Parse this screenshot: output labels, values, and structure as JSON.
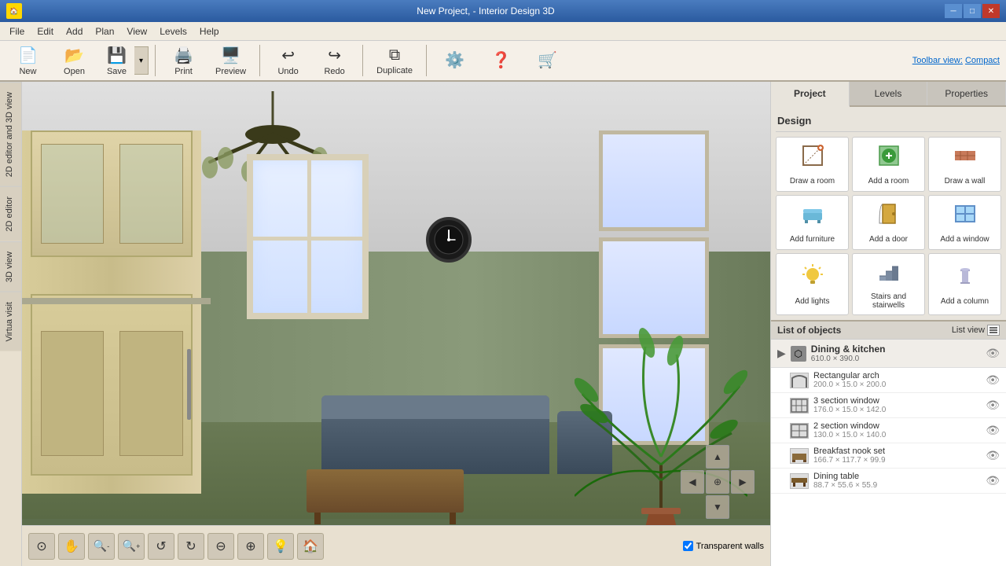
{
  "window": {
    "title": "New Project, - Interior Design 3D",
    "controls": {
      "minimize": "─",
      "restore": "□",
      "close": "✕"
    }
  },
  "menubar": {
    "items": [
      "File",
      "Edit",
      "Add",
      "Plan",
      "View",
      "Levels",
      "Help"
    ]
  },
  "toolbar": {
    "buttons": [
      {
        "label": "New",
        "icon": "📄"
      },
      {
        "label": "Open",
        "icon": "📂"
      },
      {
        "label": "Save",
        "icon": "💾"
      },
      {
        "label": "Print",
        "icon": "🖨️"
      },
      {
        "label": "Preview",
        "icon": "🖥️"
      },
      {
        "label": "Undo",
        "icon": "↩"
      },
      {
        "label": "Redo",
        "icon": "↪"
      },
      {
        "label": "Duplicate",
        "icon": "⧉"
      }
    ],
    "view_label": "Toolbar view:",
    "view_option": "Compact"
  },
  "left_tabs": [
    "2D editor and 3D view",
    "2D editor",
    "3D view",
    "Virtua visit"
  ],
  "nav_buttons": [
    {
      "icon": "⊙",
      "name": "360-view"
    },
    {
      "icon": "✋",
      "name": "pan"
    },
    {
      "icon": "🔍-",
      "name": "zoom-out"
    },
    {
      "icon": "🔍+",
      "name": "zoom-in"
    },
    {
      "icon": "↺",
      "name": "rotate-left"
    },
    {
      "icon": "↻",
      "name": "rotate-right"
    },
    {
      "icon": "⊖",
      "name": "orbit"
    },
    {
      "icon": "⊕",
      "name": "orbit-alt"
    },
    {
      "icon": "💡",
      "name": "lights"
    },
    {
      "icon": "🏠",
      "name": "home"
    }
  ],
  "transparent_walls": {
    "label": "Transparent walls",
    "checked": true
  },
  "move_controls": {
    "up": "▲",
    "left": "◀",
    "center": "⊕",
    "right": "▶",
    "down": "▼"
  },
  "right_panel": {
    "tabs": [
      "Project",
      "Levels",
      "Properties"
    ],
    "active_tab": "Project",
    "design_section_title": "Design",
    "design_buttons": [
      {
        "label": "Draw a room",
        "icon": "🏠"
      },
      {
        "label": "Add a room",
        "icon": "➕"
      },
      {
        "label": "Draw a wall",
        "icon": "🧱"
      },
      {
        "label": "Add furniture",
        "icon": "🛋"
      },
      {
        "label": "Add a door",
        "icon": "🚪"
      },
      {
        "label": "Add a window",
        "icon": "🪟"
      },
      {
        "label": "Add lights",
        "icon": "💡"
      },
      {
        "label": "Stairs and stairwells",
        "icon": "🪜"
      },
      {
        "label": "Add a column",
        "icon": "🏛"
      }
    ],
    "list_section_title": "List of objects",
    "list_view_label": "List view",
    "objects": {
      "group": {
        "name": "Dining & kitchen",
        "size": "610.0 × 390.0"
      },
      "items": [
        {
          "name": "Rectangular arch",
          "size": "200.0 × 15.0 × 200.0"
        },
        {
          "name": "3 section window",
          "size": "176.0 × 15.0 × 142.0"
        },
        {
          "name": "2 section window",
          "size": "130.0 × 15.0 × 140.0"
        },
        {
          "name": "Breakfast nook set",
          "size": "166.7 × 117.7 × 99.9"
        },
        {
          "name": "Dining table",
          "size": "88.7 × 55.6 × 55.9"
        }
      ]
    }
  }
}
